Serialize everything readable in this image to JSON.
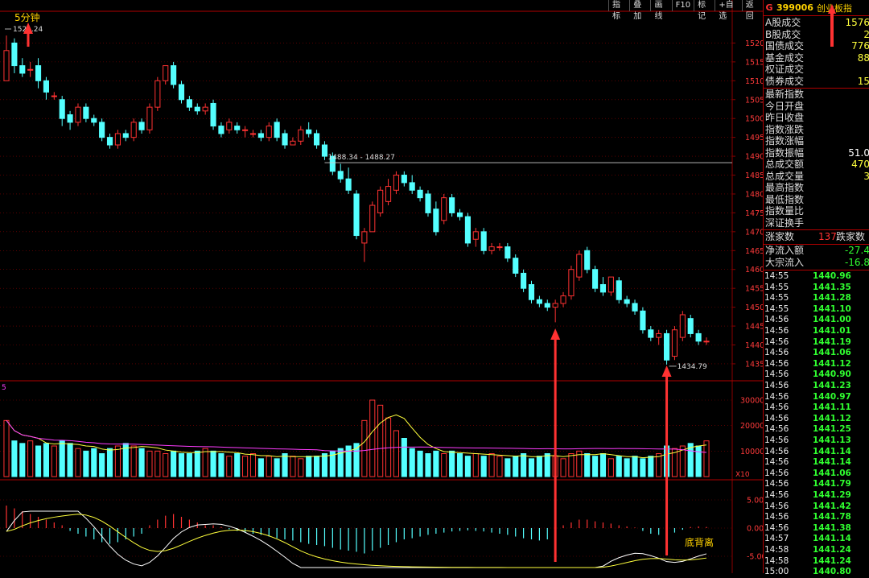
{
  "toolbar": {
    "buttons": [
      "指标",
      "叠加",
      "画线",
      "F10",
      "标记",
      "+自选",
      "返回"
    ]
  },
  "chart": {
    "period_label": "5分钟",
    "top_price_label": "1521.24",
    "hline_label": "1488.34 - 1488.27",
    "low_label": "1434.79",
    "divergence_label": "底背离",
    "volume_marker": "5",
    "volume_unit": "X10",
    "price_axis_labels": [
      "1520",
      "1515",
      "1510",
      "1505",
      "1500",
      "1495",
      "1490",
      "1485",
      "1480",
      "1475",
      "1470",
      "1465",
      "1460",
      "1455",
      "1450",
      "1445",
      "1440",
      "1435"
    ],
    "volume_axis_labels": [
      "30000",
      "20000",
      "10000"
    ],
    "macd_axis_labels": [
      "5.00",
      "0.00",
      "-5.00"
    ],
    "colors": {
      "up": "#ff3232",
      "down": "#54ffff",
      "grid": "#8b0000",
      "axis_text": "#ff3a3a",
      "ma_white": "#ffffff",
      "ma_yellow": "#ffff3c",
      "ma_magenta": "#ff3cff",
      "annotation_arrow": "#ff3232"
    }
  },
  "chart_data": {
    "type": "candlestick",
    "interval": "5min",
    "ylim": [
      1432,
      1525
    ],
    "candles": [
      {
        "o": 1510,
        "c": 1518,
        "h": 1522,
        "l": 1510
      },
      {
        "o": 1520,
        "c": 1514,
        "h": 1521.24,
        "l": 1512
      },
      {
        "o": 1514,
        "c": 1512,
        "h": 1516,
        "l": 1511
      },
      {
        "o": 1513,
        "c": 1513,
        "h": 1515,
        "l": 1511
      },
      {
        "o": 1514,
        "c": 1510,
        "h": 1516,
        "l": 1508
      },
      {
        "o": 1510,
        "c": 1507,
        "h": 1511,
        "l": 1505
      },
      {
        "o": 1506,
        "c": 1506,
        "h": 1507,
        "l": 1505
      },
      {
        "o": 1505,
        "c": 1500,
        "h": 1506,
        "l": 1498
      },
      {
        "o": 1501,
        "c": 1499,
        "h": 1502,
        "l": 1497
      },
      {
        "o": 1499,
        "c": 1503,
        "h": 1504,
        "l": 1498
      },
      {
        "o": 1503,
        "c": 1500,
        "h": 1504,
        "l": 1499
      },
      {
        "o": 1500,
        "c": 1499,
        "h": 1501,
        "l": 1498
      },
      {
        "o": 1499,
        "c": 1495,
        "h": 1500,
        "l": 1494
      },
      {
        "o": 1495,
        "c": 1493,
        "h": 1496,
        "l": 1492
      },
      {
        "o": 1493,
        "c": 1496,
        "h": 1497,
        "l": 1492
      },
      {
        "o": 1496,
        "c": 1495,
        "h": 1497,
        "l": 1494
      },
      {
        "o": 1495,
        "c": 1499,
        "h": 1500,
        "l": 1494
      },
      {
        "o": 1499,
        "c": 1497,
        "h": 1500,
        "l": 1496
      },
      {
        "o": 1497,
        "c": 1503,
        "h": 1504,
        "l": 1496
      },
      {
        "o": 1503,
        "c": 1510,
        "h": 1511,
        "l": 1502
      },
      {
        "o": 1510,
        "c": 1514,
        "h": 1514,
        "l": 1509
      },
      {
        "o": 1514,
        "c": 1509,
        "h": 1515,
        "l": 1508
      },
      {
        "o": 1509,
        "c": 1505,
        "h": 1510,
        "l": 1504
      },
      {
        "o": 1505,
        "c": 1503,
        "h": 1506,
        "l": 1502
      },
      {
        "o": 1503,
        "c": 1502,
        "h": 1504,
        "l": 1501
      },
      {
        "o": 1502,
        "c": 1503,
        "h": 1504,
        "l": 1501
      },
      {
        "o": 1504,
        "c": 1498,
        "h": 1505,
        "l": 1497
      },
      {
        "o": 1498,
        "c": 1496,
        "h": 1499,
        "l": 1495
      },
      {
        "o": 1497,
        "c": 1499,
        "h": 1500,
        "l": 1496
      },
      {
        "o": 1498,
        "c": 1497,
        "h": 1499,
        "l": 1496
      },
      {
        "o": 1497,
        "c": 1497,
        "h": 1498,
        "l": 1495
      },
      {
        "o": 1496,
        "c": 1496,
        "h": 1497,
        "l": 1495
      },
      {
        "o": 1496,
        "c": 1495,
        "h": 1497,
        "l": 1494
      },
      {
        "o": 1495,
        "c": 1498,
        "h": 1499,
        "l": 1494
      },
      {
        "o": 1499,
        "c": 1495,
        "h": 1500,
        "l": 1494
      },
      {
        "o": 1496,
        "c": 1493,
        "h": 1497,
        "l": 1492
      },
      {
        "o": 1493,
        "c": 1494,
        "h": 1495,
        "l": 1493
      },
      {
        "o": 1494,
        "c": 1497,
        "h": 1498,
        "l": 1493
      },
      {
        "o": 1497,
        "c": 1496,
        "h": 1499,
        "l": 1495
      },
      {
        "o": 1496,
        "c": 1493,
        "h": 1497,
        "l": 1492
      },
      {
        "o": 1493,
        "c": 1490,
        "h": 1494,
        "l": 1489
      },
      {
        "o": 1490,
        "c": 1486,
        "h": 1491,
        "l": 1485
      },
      {
        "o": 1486,
        "c": 1484,
        "h": 1488,
        "l": 1483
      },
      {
        "o": 1484,
        "c": 1481,
        "h": 1487,
        "l": 1480
      },
      {
        "o": 1480,
        "c": 1469,
        "h": 1481,
        "l": 1468
      },
      {
        "o": 1467,
        "c": 1470,
        "h": 1471,
        "l": 1462
      },
      {
        "o": 1470,
        "c": 1477,
        "h": 1478,
        "l": 1470
      },
      {
        "o": 1475,
        "c": 1481,
        "h": 1482,
        "l": 1474
      },
      {
        "o": 1478,
        "c": 1482,
        "h": 1484,
        "l": 1477
      },
      {
        "o": 1481,
        "c": 1485,
        "h": 1486,
        "l": 1480
      },
      {
        "o": 1485,
        "c": 1483,
        "h": 1486,
        "l": 1482
      },
      {
        "o": 1483,
        "c": 1481,
        "h": 1485,
        "l": 1480
      },
      {
        "o": 1481,
        "c": 1479,
        "h": 1482,
        "l": 1478
      },
      {
        "o": 1480,
        "c": 1475,
        "h": 1481,
        "l": 1474
      },
      {
        "o": 1476,
        "c": 1470,
        "h": 1478,
        "l": 1469
      },
      {
        "o": 1473,
        "c": 1479,
        "h": 1480,
        "l": 1472
      },
      {
        "o": 1479,
        "c": 1475,
        "h": 1480,
        "l": 1474
      },
      {
        "o": 1475,
        "c": 1474,
        "h": 1476,
        "l": 1473
      },
      {
        "o": 1474,
        "c": 1467,
        "h": 1475,
        "l": 1466
      },
      {
        "o": 1468,
        "c": 1470,
        "h": 1471,
        "l": 1466
      },
      {
        "o": 1470,
        "c": 1465,
        "h": 1471,
        "l": 1464
      },
      {
        "o": 1465,
        "c": 1466,
        "h": 1467,
        "l": 1464
      },
      {
        "o": 1466,
        "c": 1466,
        "h": 1467,
        "l": 1465
      },
      {
        "o": 1466,
        "c": 1463,
        "h": 1467,
        "l": 1462
      },
      {
        "o": 1463,
        "c": 1459,
        "h": 1464,
        "l": 1458
      },
      {
        "o": 1459,
        "c": 1455,
        "h": 1460,
        "l": 1454
      },
      {
        "o": 1456,
        "c": 1452,
        "h": 1457,
        "l": 1451
      },
      {
        "o": 1452,
        "c": 1451,
        "h": 1453,
        "l": 1450
      },
      {
        "o": 1451,
        "c": 1450,
        "h": 1452,
        "l": 1449
      },
      {
        "o": 1450,
        "c": 1451,
        "h": 1452,
        "l": 1446
      },
      {
        "o": 1451,
        "c": 1453,
        "h": 1454,
        "l": 1450
      },
      {
        "o": 1453,
        "c": 1460,
        "h": 1461,
        "l": 1452
      },
      {
        "o": 1458,
        "c": 1464,
        "h": 1465,
        "l": 1457
      },
      {
        "o": 1465,
        "c": 1460,
        "h": 1466,
        "l": 1459
      },
      {
        "o": 1460,
        "c": 1455,
        "h": 1461,
        "l": 1454
      },
      {
        "o": 1456,
        "c": 1454,
        "h": 1458,
        "l": 1453
      },
      {
        "o": 1454,
        "c": 1458,
        "h": 1458,
        "l": 1453
      },
      {
        "o": 1457,
        "c": 1452,
        "h": 1458,
        "l": 1451
      },
      {
        "o": 1452,
        "c": 1451,
        "h": 1453,
        "l": 1450
      },
      {
        "o": 1451,
        "c": 1449,
        "h": 1452,
        "l": 1448
      },
      {
        "o": 1449,
        "c": 1444,
        "h": 1450,
        "l": 1443
      },
      {
        "o": 1444,
        "c": 1442,
        "h": 1445,
        "l": 1441
      },
      {
        "o": 1442,
        "c": 1443,
        "h": 1444,
        "l": 1440
      },
      {
        "o": 1443,
        "c": 1436,
        "h": 1444,
        "l": 1434.79
      },
      {
        "o": 1437,
        "c": 1444,
        "h": 1445,
        "l": 1436
      },
      {
        "o": 1442,
        "c": 1448,
        "h": 1449,
        "l": 1441
      },
      {
        "o": 1447,
        "c": 1443,
        "h": 1448,
        "l": 1442
      },
      {
        "o": 1443,
        "c": 1441,
        "h": 1444,
        "l": 1440
      },
      {
        "o": 1441,
        "c": 1441,
        "h": 1442,
        "l": 1440
      }
    ],
    "volume_ylim": [
      0,
      36000
    ],
    "volumes": [
      22000,
      14000,
      13000,
      14000,
      12000,
      13000,
      12000,
      14000,
      13000,
      11000,
      10000,
      11000,
      9000,
      11000,
      12000,
      13000,
      12000,
      11000,
      10000,
      10000,
      9000,
      10000,
      9000,
      9000,
      10000,
      11000,
      10000,
      9000,
      8000,
      9000,
      8000,
      9000,
      7000,
      8000,
      7000,
      9000,
      8000,
      7000,
      8000,
      8000,
      9000,
      10000,
      11000,
      12000,
      13000,
      22000,
      30000,
      28000,
      23000,
      18000,
      15000,
      11000,
      10000,
      9000,
      10000,
      9000,
      10000,
      9000,
      8000,
      9000,
      8000,
      9000,
      8000,
      7000,
      8000,
      9000,
      7000,
      8000,
      9000,
      8000,
      7000,
      9000,
      10000,
      9000,
      8000,
      9000,
      7000,
      8000,
      7000,
      8000,
      7000,
      8000,
      9000,
      12000,
      11000,
      12000,
      13000,
      12000,
      14000
    ],
    "macd_ylim": [
      -8,
      8
    ],
    "macd_hist": [
      4,
      3.5,
      3,
      2.5,
      2,
      1.5,
      1,
      0.5,
      -0.5,
      -1,
      -1.5,
      -2,
      -2.5,
      -2.8,
      -2.5,
      -2,
      -1.5,
      -1,
      0.5,
      1.5,
      2.2,
      2.5,
      2,
      1.5,
      1,
      0.5,
      0.5,
      0.2,
      -0.2,
      -0.5,
      -0.8,
      -1,
      -1.2,
      -1.5,
      -1.8,
      -2,
      -2.2,
      -2.5,
      -2.8,
      -3,
      -3.2,
      -3.5,
      -3.8,
      -4,
      -4.2,
      -4.5,
      -4,
      -3.5,
      -3,
      -2.5,
      -2,
      -1.8,
      -1.5,
      -1.2,
      -1,
      -0.8,
      -0.6,
      -0.5,
      -0.4,
      -0.5,
      -0.6,
      -0.8,
      -1,
      -1.2,
      -1.5,
      -1.8,
      -2,
      -2.2,
      -2,
      -1.5,
      0.5,
      1,
      1.5,
      1.5,
      1.2,
      1,
      0.8,
      0.5,
      0.3,
      0.1,
      -0.5,
      -1,
      -1.2,
      -1.5,
      -0.8,
      -0.3,
      0.2,
      0.3,
      0.2
    ]
  },
  "right_panel": {
    "header": {
      "market": "G",
      "code": "399006",
      "name": "创业板指"
    },
    "stats": [
      {
        "label": "A股成交",
        "value": "1576",
        "color": "#ffff3c"
      },
      {
        "label": "B股成交",
        "value": "2",
        "color": "#ffff3c"
      },
      {
        "label": "国债成交",
        "value": "776",
        "color": "#ffff3c"
      },
      {
        "label": "基金成交",
        "value": "88",
        "color": "#ffff3c"
      },
      {
        "label": "权证成交",
        "value": "",
        "color": "#ffff3c"
      },
      {
        "label": "债券成交",
        "value": "15",
        "color": "#ffff3c"
      },
      {
        "label": "最新指数",
        "value": "",
        "color": "#ffffff"
      },
      {
        "label": "今日开盘",
        "value": "",
        "color": "#ffffff"
      },
      {
        "label": "昨日收盘",
        "value": "",
        "color": "#ffffff"
      },
      {
        "label": "指数涨跌",
        "value": "",
        "color": "#ffffff"
      },
      {
        "label": "指数涨幅",
        "value": "",
        "color": "#ffffff"
      },
      {
        "label": "指数振幅",
        "value": "51.0",
        "color": "#ffffff"
      },
      {
        "label": "总成交额",
        "value": "470",
        "color": "#ffff3c"
      },
      {
        "label": "总成交量",
        "value": "3",
        "color": "#ffff3c"
      },
      {
        "label": "最高指数",
        "value": "",
        "color": "#ffffff"
      },
      {
        "label": "最低指数",
        "value": "",
        "color": "#ffffff"
      },
      {
        "label": "指数量比",
        "value": "",
        "color": "#ffffff"
      },
      {
        "label": "深证换手",
        "value": "",
        "color": "#ffffff"
      }
    ],
    "breadth": {
      "up_label": "涨家数",
      "up_value": "137",
      "down_label": "跌家数"
    },
    "flows": [
      {
        "label": "净流入额",
        "value": "-27.4",
        "color": "#30ff30"
      },
      {
        "label": "大宗流入",
        "value": "-16.8",
        "color": "#30ff30"
      }
    ],
    "ticks": [
      {
        "time": "14:55",
        "price": "1440.96"
      },
      {
        "time": "14:55",
        "price": "1441.35"
      },
      {
        "time": "14:55",
        "price": "1441.28"
      },
      {
        "time": "14:55",
        "price": "1441.10"
      },
      {
        "time": "14:56",
        "price": "1441.00"
      },
      {
        "time": "14:56",
        "price": "1441.01"
      },
      {
        "time": "14:56",
        "price": "1441.19"
      },
      {
        "time": "14:56",
        "price": "1441.06"
      },
      {
        "time": "14:56",
        "price": "1441.12"
      },
      {
        "time": "14:56",
        "price": "1440.90"
      },
      {
        "time": "14:56",
        "price": "1441.23"
      },
      {
        "time": "14:56",
        "price": "1440.97"
      },
      {
        "time": "14:56",
        "price": "1441.11"
      },
      {
        "time": "14:56",
        "price": "1441.12"
      },
      {
        "time": "14:56",
        "price": "1441.25"
      },
      {
        "time": "14:56",
        "price": "1441.13"
      },
      {
        "time": "14:56",
        "price": "1441.14"
      },
      {
        "time": "14:56",
        "price": "1441.14"
      },
      {
        "time": "14:56",
        "price": "1441.06"
      },
      {
        "time": "14:56",
        "price": "1441.79"
      },
      {
        "time": "14:56",
        "price": "1441.29"
      },
      {
        "time": "14:56",
        "price": "1441.42"
      },
      {
        "time": "14:56",
        "price": "1441.78"
      },
      {
        "time": "14:56",
        "price": "1441.38"
      },
      {
        "time": "14:57",
        "price": "1441.14"
      },
      {
        "time": "14:58",
        "price": "1441.24"
      },
      {
        "time": "14:58",
        "price": "1441.24"
      },
      {
        "time": "15:00",
        "price": "1440.80"
      }
    ]
  }
}
